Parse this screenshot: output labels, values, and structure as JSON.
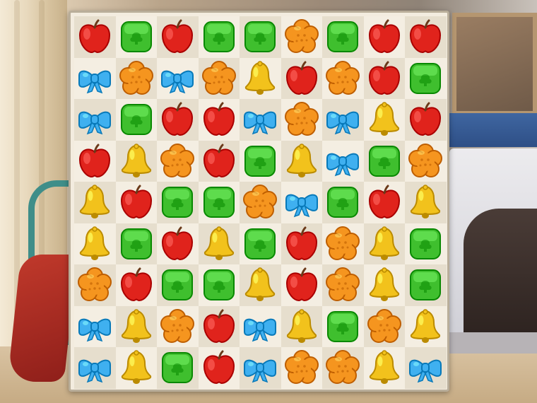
{
  "game": {
    "board_rows": [
      [
        "apple",
        "square",
        "apple",
        "square",
        "square",
        "flower",
        "square",
        "apple",
        "apple"
      ],
      [
        "bow",
        "flower",
        "bow",
        "flower",
        "bell",
        "apple",
        "flower",
        "apple",
        "square"
      ],
      [
        "bow",
        "square",
        "apple",
        "apple",
        "bow",
        "flower",
        "bow",
        "bell",
        "apple"
      ],
      [
        "apple",
        "bell",
        "flower",
        "apple",
        "square",
        "bell",
        "bow",
        "square",
        "flower"
      ],
      [
        "bell",
        "apple",
        "square",
        "square",
        "flower",
        "bow",
        "square",
        "apple",
        "bell"
      ],
      [
        "bell",
        "square",
        "apple",
        "bell",
        "square",
        "apple",
        "flower",
        "bell",
        "square"
      ],
      [
        "flower",
        "apple",
        "square",
        "square",
        "bell",
        "apple",
        "flower",
        "bell",
        "square"
      ],
      [
        "bow",
        "bell",
        "flower",
        "apple",
        "bow",
        "bell",
        "square",
        "flower",
        "bell"
      ],
      [
        "bow",
        "bell",
        "square",
        "apple",
        "bow",
        "flower",
        "flower",
        "bell",
        "bow"
      ]
    ],
    "piece_colors": {
      "apple": "#e0231c",
      "square": "#3fbf2e",
      "flower": "#f5951f",
      "bow": "#3fb0f0",
      "bell": "#f2c21c"
    },
    "piece_icons": {
      "apple": "apple-icon",
      "square": "green-square-icon",
      "flower": "orange-flower-icon",
      "bow": "blue-bow-icon",
      "bell": "yellow-bell-icon"
    }
  }
}
